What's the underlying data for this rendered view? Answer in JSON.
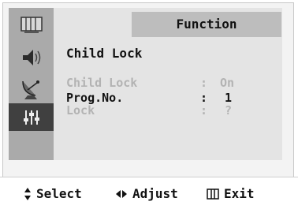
{
  "menu": {
    "header_title": "Function",
    "screen_title": "Child Lock",
    "sidebar_icons": [
      "picture-icon",
      "sound-icon",
      "channel-antenna-icon",
      "function-sliders-icon"
    ],
    "rows": [
      {
        "label": "Child Lock",
        "sep": ":",
        "value": "On",
        "state": "dim"
      },
      {
        "label": "Prog.No.",
        "sep": ":",
        "value": "1",
        "state": "selected"
      },
      {
        "label": "Lock",
        "sep": ":",
        "value": "?",
        "state": "dim"
      }
    ]
  },
  "footer": {
    "select_label": "Select",
    "adjust_label": "Adjust",
    "exit_label": "Exit"
  },
  "colors": {
    "sidebar": "#aaaaaa",
    "active_icon_bg": "#404040",
    "content_bg": "#e4e4e4",
    "header_bg": "#bdbdbd",
    "dim_text": "#b3b3b3"
  }
}
